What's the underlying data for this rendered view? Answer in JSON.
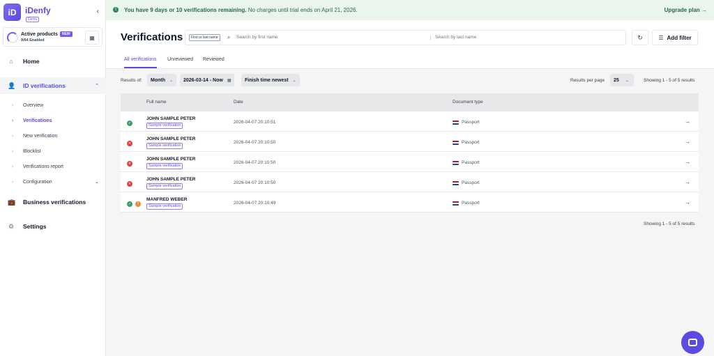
{
  "sidebar": {
    "logo_text": "iD",
    "brand": "iDenfy",
    "brand_badge": "Demo",
    "collapse_icon": "chevron-left-icon",
    "products": {
      "label": "Active products",
      "badge": "NEW",
      "count": "9/64 Enabled"
    },
    "nav": {
      "home": "Home",
      "id_verifications": "ID verifications",
      "business_verifications": "Business verifications",
      "settings": "Settings"
    },
    "sub": {
      "overview": "Overview",
      "verifications": "Verifications",
      "new_verification": "New verification",
      "blocklist": "Blocklist",
      "verifications_report": "Verifications report",
      "configuration": "Configuration"
    }
  },
  "banner": {
    "bold_text": "You have 9 days or 10 verifications remaining.",
    "text": " No charges until trial ends on April 21, 2026.",
    "upgrade": "Upgrade plan →",
    "color": "#276749"
  },
  "header": {
    "title": "Verifications",
    "search_chip": "First or last name",
    "search_first_placeholder": "Search by first name",
    "search_last_placeholder": "Search by last name",
    "add_filter": "Add filter"
  },
  "tabs": {
    "all": "All verifications",
    "unreviewed": "Unreviewed",
    "reviewed": "Reviewed"
  },
  "filters": {
    "results_of": "Results of:",
    "period": "Month",
    "date_range": "2026-03-14 - Now",
    "sort": "Finish time newest",
    "results_per_page_label": "Results per page",
    "results_per_page": "25",
    "showing": "Showing 1 - 5 of 5 results"
  },
  "table": {
    "columns": {
      "full_name": "Full name",
      "date": "Date",
      "document_type": "Document type"
    },
    "rows": [
      {
        "name": "JOHN SAMPLE PETER",
        "tag": "Sample verification",
        "date": "2026-04-07 20:10:51",
        "doc": "Passport",
        "status": "approved"
      },
      {
        "name": "JOHN SAMPLE PETER",
        "tag": "Sample verification",
        "date": "2026-04-07 20:10:50",
        "doc": "Passport",
        "status": "denied"
      },
      {
        "name": "JOHN SAMPLE PETER",
        "tag": "Sample verification",
        "date": "2026-04-07 20:10:50",
        "doc": "Passport",
        "status": "denied"
      },
      {
        "name": "JOHN SAMPLE PETER",
        "tag": "Sample verification",
        "date": "2026-04-07 20:10:50",
        "doc": "Passport",
        "status": "denied"
      },
      {
        "name": "MANFRED WEBER",
        "tag": "Sample verification",
        "date": "2026-04-07 20:10:49",
        "doc": "Passport",
        "status": "approved-warning"
      }
    ]
  },
  "footer": {
    "showing": "Showing 1 - 5 of 5 results"
  },
  "colors": {
    "accent": "#5b4be0",
    "approved": "#38a169",
    "denied": "#e53e3e",
    "warning": "#ed8936"
  }
}
